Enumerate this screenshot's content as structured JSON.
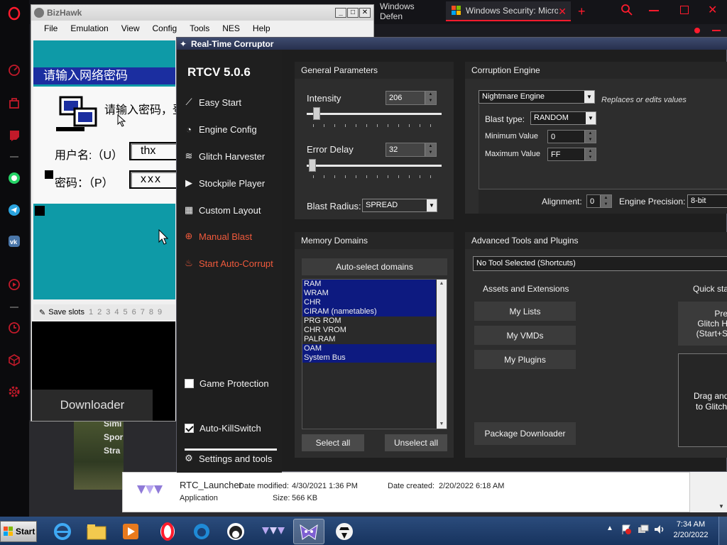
{
  "opera": {
    "tabs": [
      {
        "title": "Windows Defen"
      },
      {
        "title": "Windows Security: Microso"
      }
    ],
    "sidebar_icons": [
      "opera-icon",
      "speed-icon",
      "bag-icon",
      "twitch-icon",
      "dash-icon",
      "whatsapp-icon",
      "telegram-icon",
      "vk-icon",
      "play-icon",
      "dash-icon",
      "clock-icon",
      "cube-icon",
      "gear-icon"
    ],
    "accent": "#ff1b2d"
  },
  "bizhawk": {
    "title": "BizHawk",
    "menu": [
      "File",
      "Emulation",
      "View",
      "Config",
      "Tools",
      "NES",
      "Help"
    ],
    "game": {
      "header": "请输入网络密码",
      "prompt": "请输入密码，登",
      "user_label": "用户名:（U）",
      "user_value": "thx",
      "pass_label": "密码：（P）",
      "pass_value": "xxx"
    },
    "save_slots_label": "Save slots",
    "save_slots": [
      "1",
      "2",
      "3",
      "4",
      "5",
      "6",
      "7",
      "8",
      "9"
    ],
    "downloader": "Downloader"
  },
  "game_thumb_text": [
    "Simi",
    "Spor",
    "Stra"
  ],
  "rtcv": {
    "title": "Real-Time Corruptor",
    "version": "RTCV 5.0.6",
    "nav": [
      {
        "label": "Easy Start",
        "icon": "wand-icon"
      },
      {
        "label": "Engine Config",
        "icon": "gauge-icon"
      },
      {
        "label": "Glitch Harvester",
        "icon": "layers-icon"
      },
      {
        "label": "Stockpile Player",
        "icon": "play-icon"
      },
      {
        "label": "Custom Layout",
        "icon": "grid-icon"
      },
      {
        "label": "Manual Blast",
        "icon": "target-icon"
      },
      {
        "label": "Start Auto-Corrupt",
        "icon": "flame-icon"
      }
    ],
    "game_protection": {
      "label": "Game Protection",
      "checked": false
    },
    "auto_killswitch": {
      "label": "Auto-KillSwitch",
      "checked": true
    },
    "settings": "Settings and tools",
    "general": {
      "header": "General Parameters",
      "intensity_label": "Intensity",
      "intensity_value": "206",
      "error_delay_label": "Error Delay",
      "error_delay_value": "32",
      "blast_radius_label": "Blast Radius:",
      "blast_radius_value": "SPREAD"
    },
    "engine": {
      "header": "Corruption Engine",
      "engine_value": "Nightmare Engine",
      "engine_desc": "Replaces or edits values",
      "blast_type_label": "Blast type:",
      "blast_type_value": "RANDOM",
      "min_label": "Minimum Value",
      "min_value": "0",
      "max_label": "Maximum Value",
      "max_value": "FF",
      "alignment_label": "Alignment:",
      "alignment_value": "0",
      "precision_label": "Engine Precision:",
      "precision_value": "8-bit"
    },
    "memory": {
      "header": "Memory Domains",
      "auto_select": "Auto-select domains",
      "domains": [
        {
          "name": "RAM",
          "selected": true
        },
        {
          "name": "WRAM",
          "selected": true
        },
        {
          "name": "CHR",
          "selected": true
        },
        {
          "name": "CIRAM (nametables)",
          "selected": true
        },
        {
          "name": "PRG ROM",
          "selected": false
        },
        {
          "name": "CHR VROM",
          "selected": false
        },
        {
          "name": "PALRAM",
          "selected": false
        },
        {
          "name": "OAM",
          "selected": true
        },
        {
          "name": "System Bus",
          "selected": true
        }
      ],
      "select_all": "Select all",
      "unselect_all": "Unselect all"
    },
    "tools": {
      "header": "Advanced Tools and Plugins",
      "tool_select": "No Tool Selected (Shortcuts)",
      "assets_header": "Assets and Extensions",
      "my_lists": "My Lists",
      "my_vmds": "My VMDs",
      "my_plugins": "My Plugins",
      "package_downloader": "Package Downloader",
      "quick_header": "Quick sta",
      "quick_btn_line1": "Pre",
      "quick_btn_line2": "Glitch H",
      "quick_btn_line3": "(Start+S",
      "drag_line1": "Drag and",
      "drag_line2": "to Glitch"
    }
  },
  "explorer": {
    "name": "RTC_Launcher",
    "type": "Application",
    "date_modified_label": "Date modified:",
    "date_modified": "4/30/2021 1:36 PM",
    "size_label": "Size:",
    "size": "566 KB",
    "date_created_label": "Date created:",
    "date_created": "2/20/2022 6:18 AM"
  },
  "taskbar": {
    "start": "Start",
    "apps": [
      "ie-icon",
      "folder-icon",
      "media-player-icon",
      "opera-icon",
      "edge-icon",
      "penguin-icon",
      "rtc-launcher-icon",
      "rtcv-icon",
      "spy-icon"
    ],
    "time": "7:34 AM",
    "date": "2/20/2022"
  }
}
